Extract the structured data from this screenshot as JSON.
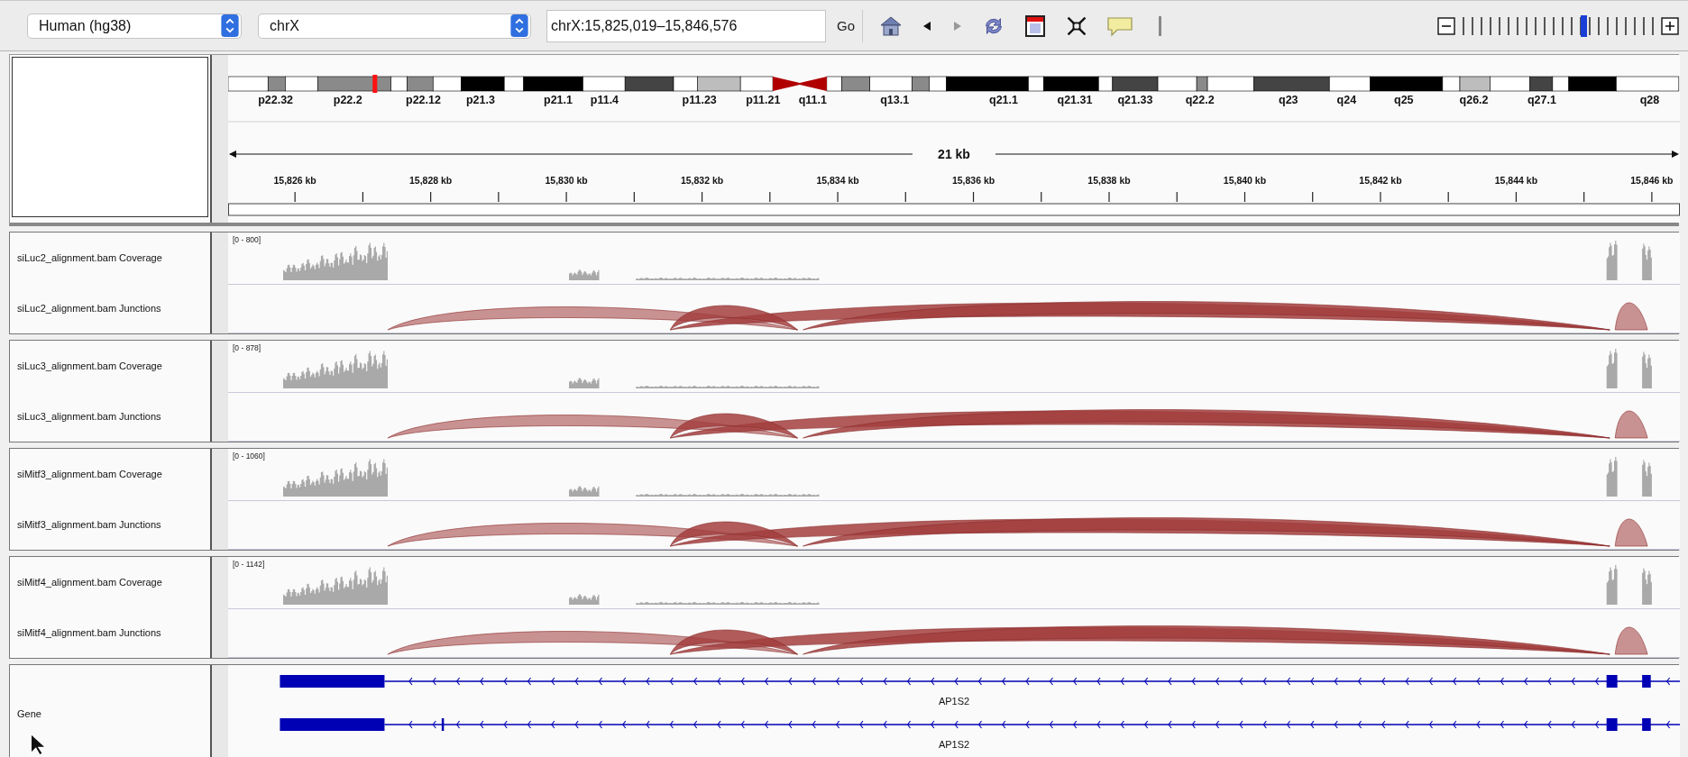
{
  "toolbar": {
    "genome": "Human (hg38)",
    "chromosome": "chrX",
    "locus": "chrX:15,825,019–15,846,576",
    "go": "Go",
    "zoom": {
      "level": 0.63
    }
  },
  "ideogram": {
    "bands": [
      "p22.32",
      "p22.2",
      "p22.12",
      "p21.3",
      "p21.1",
      "p11.4",
      "p11.23",
      "p11.21",
      "q11.1",
      "q13.1",
      "q21.1",
      "q21.31",
      "q21.33",
      "q22.2",
      "q23",
      "q24",
      "q25",
      "q26.2",
      "q27.1",
      "q28"
    ]
  },
  "ruler": {
    "span": "21 kb",
    "ticks": [
      "15,826 kb",
      "15,828 kb",
      "15,830 kb",
      "15,832 kb",
      "15,834 kb",
      "15,836 kb",
      "15,838 kb",
      "15,840 kb",
      "15,842 kb",
      "15,844 kb",
      "15,846 kb"
    ]
  },
  "track_groups": [
    {
      "coverage_name": "siLuc2_alignment.bam Coverage",
      "range": "[0 - 800]",
      "junctions_name": "siLuc2_alignment.bam Junctions"
    },
    {
      "coverage_name": "siLuc3_alignment.bam Coverage",
      "range": "[0 - 878]",
      "junctions_name": "siLuc3_alignment.bam Junctions"
    },
    {
      "coverage_name": "siMitf3_alignment.bam Coverage",
      "range": "[0 - 1060]",
      "junctions_name": "siMitf3_alignment.bam Junctions"
    },
    {
      "coverage_name": "siMitf4_alignment.bam Coverage",
      "range": "[0 - 1142]",
      "junctions_name": "siMitf4_alignment.bam Junctions"
    }
  ],
  "gene_track": {
    "name": "Gene",
    "transcripts": [
      {
        "label": "AP1S2",
        "kind": "short"
      },
      {
        "label": "AP1S2",
        "kind": "extra-exon"
      }
    ]
  }
}
